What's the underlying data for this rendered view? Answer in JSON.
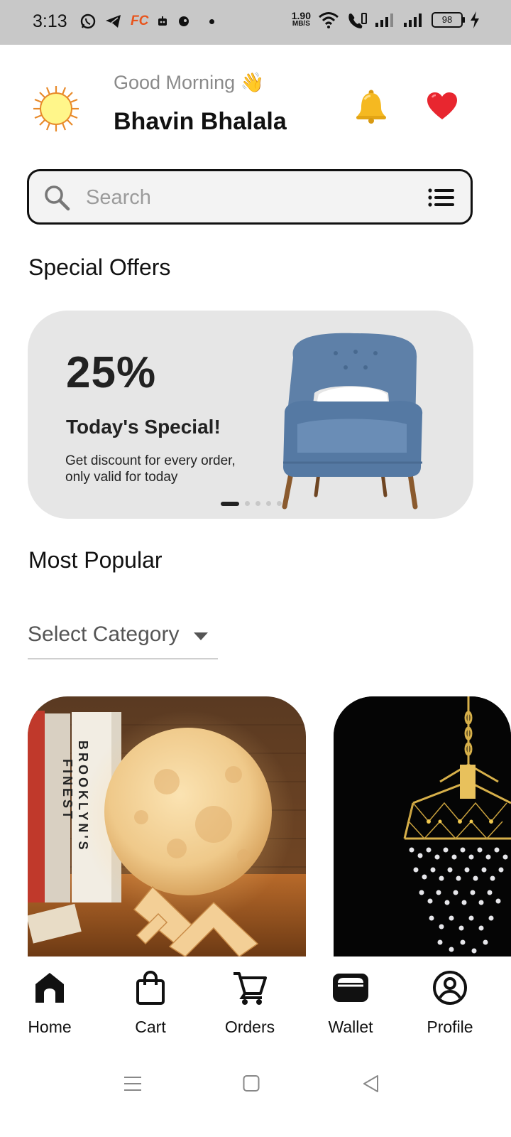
{
  "status_bar": {
    "time": "3:13",
    "net_speed_value": "1.90",
    "net_speed_unit": "MB/S",
    "battery": "98",
    "fc_badge": "FC"
  },
  "header": {
    "greeting": "Good Morning 👋",
    "user_name": "Bhavin Bhalala"
  },
  "search": {
    "placeholder": "Search",
    "value": ""
  },
  "special_offers": {
    "title": "Special Offers",
    "banner": {
      "percent": "25%",
      "heading": "Today's Special!",
      "description": "Get discount for every order, only valid for today",
      "slide_index": 1,
      "slide_count": 5
    }
  },
  "most_popular": {
    "title": "Most Popular",
    "category_dropdown": {
      "selected": "Select Category"
    },
    "products": [
      {
        "image": "moon-lamp-image",
        "book_spine": [
          "BROOKLYN'S",
          "FINEST"
        ]
      },
      {
        "image": "crystal-chandelier-image"
      }
    ]
  },
  "bottom_nav": {
    "items": [
      {
        "label": "Home",
        "icon": "home-icon"
      },
      {
        "label": "Cart",
        "icon": "shopping-bag-icon"
      },
      {
        "label": "Orders",
        "icon": "cart-icon"
      },
      {
        "label": "Wallet",
        "icon": "wallet-icon"
      },
      {
        "label": "Profile",
        "icon": "profile-icon"
      }
    ],
    "active": "Home"
  },
  "colors": {
    "status_bar_bg": "#c8c8c8",
    "banner_bg": "#e6e6e6",
    "search_bg": "#f3f3f3",
    "text_primary": "#111111",
    "text_muted": "#8a8a8a"
  }
}
